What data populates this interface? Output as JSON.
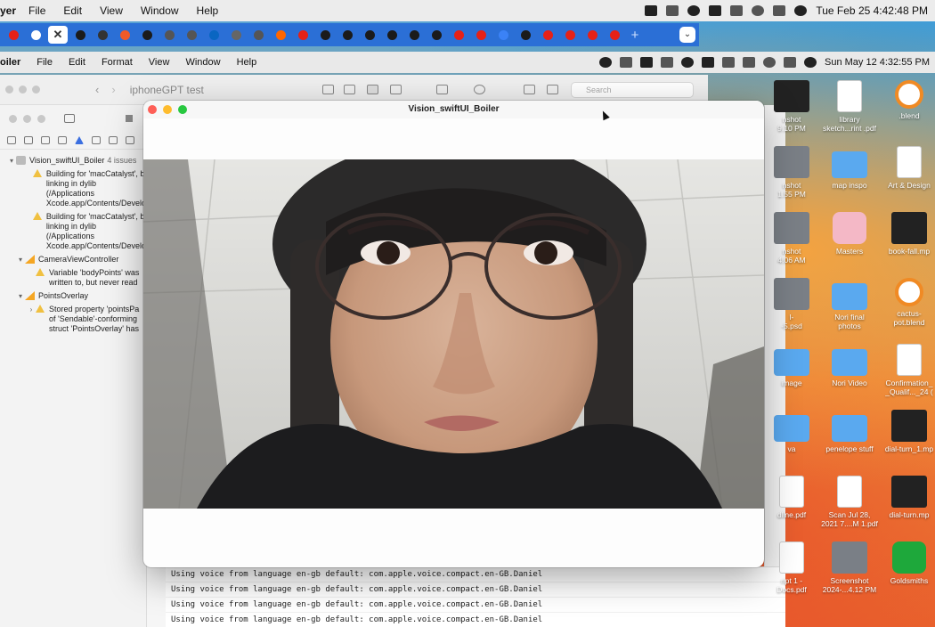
{
  "outer_menubar": {
    "app_name": "yer",
    "items": [
      "File",
      "Edit",
      "View",
      "Window",
      "Help"
    ],
    "datetime": "Tue Feb 25  4:42:48 PM"
  },
  "browser_tabs": {
    "favicon_colors": [
      "#e62117",
      "#ffffff",
      "#1b1b1b",
      "#333333",
      "#f05a28",
      "#1b1b1b",
      "#555555",
      "#555555",
      "#0a66c2",
      "#666666",
      "#555555",
      "#ff6600",
      "#e62117",
      "#1b1b1b",
      "#1b1b1b",
      "#1b1b1b",
      "#1b1b1b",
      "#1b1b1b",
      "#1b1b1b",
      "#e62117",
      "#e62117",
      "#3b82f6",
      "#1b1b1b",
      "#e62117",
      "#e62117",
      "#e62117",
      "#e62117"
    ],
    "active_tab_symbol": "✕",
    "new_tab_symbol": "+"
  },
  "inner_menubar": {
    "app_name": "oiler",
    "items": [
      "File",
      "Edit",
      "Format",
      "View",
      "Window",
      "Help"
    ],
    "datetime": "Sun May 12  4:32:55 PM"
  },
  "xcode": {
    "scheme_title": "iphoneGPT test",
    "search_placeholder": "Search",
    "issue_tree": [
      {
        "kind": "project",
        "caret": "▾",
        "label": "Vision_swiftUI_Boiler",
        "badge": "4 issues"
      },
      {
        "kind": "warning",
        "caret": "",
        "label": "Building for 'macCatalyst', b\nlinking in dylib (/Applications\nXcode.app/Contents/Develo"
      },
      {
        "kind": "warning",
        "caret": "",
        "label": "Building for 'macCatalyst', b\nlinking in dylib (/Applications\nXcode.app/Contents/Develo"
      },
      {
        "kind": "swift",
        "caret": "▾",
        "label": "CameraViewController"
      },
      {
        "kind": "warning",
        "caret": "",
        "label": "Variable 'bodyPoints' was\nwritten to, but never read"
      },
      {
        "kind": "swift",
        "caret": "▾",
        "label": "PointsOverlay"
      },
      {
        "kind": "warning",
        "caret": "›",
        "label": "Stored property 'pointsPa\nof 'Sendable'-conforming\nstruct 'PointsOverlay' has"
      }
    ]
  },
  "console": {
    "lines": [
      "Using voice from language en-gb default: com.apple.voice.compact.en-GB.Daniel",
      "Using voice from language en-gb default: com.apple.voice.compact.en-GB.Daniel",
      "Using voice from language en-gb default: com.apple.voice.compact.en-GB.Daniel",
      "Using voice from language en-gb default: com.apple.voice.compact.en-GB.Daniel"
    ]
  },
  "vision_window": {
    "title": "Vision_swiftUI_Boiler"
  },
  "desktop": {
    "items": [
      {
        "label": "nshot\n9.10 PM",
        "thumb": "dark"
      },
      {
        "label": "library\nsketch...rint .pdf",
        "thumb": "doc"
      },
      {
        "label": ".blend",
        "thumb": "blend"
      },
      {
        "label": "nshot\n1.55 PM",
        "thumb": "photo"
      },
      {
        "label": "map inspo",
        "thumb": "folder"
      },
      {
        "label": "Art & Design",
        "thumb": "doc"
      },
      {
        "label": "nshot\n4.06 AM",
        "thumb": "photo"
      },
      {
        "label": "Masters",
        "thumb": "pink"
      },
      {
        "label": "book-fall.mp",
        "thumb": "dark"
      },
      {
        "label": "l-\n-5.psd",
        "thumb": "photo"
      },
      {
        "label": "Nori final\nphotos",
        "thumb": "folder"
      },
      {
        "label": "cactus-\npot.blend",
        "thumb": "blend"
      },
      {
        "label": "image",
        "thumb": "folder"
      },
      {
        "label": "Nori Video",
        "thumb": "folder"
      },
      {
        "label": "Confirmation_\n_Qualif..._24 (",
        "thumb": "doc"
      },
      {
        "label": "va",
        "thumb": "folder"
      },
      {
        "label": "penelope stuff",
        "thumb": "folder"
      },
      {
        "label": "dial-turn_1.mp",
        "thumb": "dark"
      },
      {
        "label": "dline.pdf",
        "thumb": "doc"
      },
      {
        "label": "Scan Jul 28,\n2021 7....M 1.pdf",
        "thumb": "doc"
      },
      {
        "label": "dial-turn.mp",
        "thumb": "dark"
      },
      {
        "label": "ript 1 -\nDocs.pdf",
        "thumb": "doc"
      },
      {
        "label": "Screenshot\n2024-...4.12 PM",
        "thumb": "photo"
      },
      {
        "label": "Goldsmiths",
        "thumb": "green"
      }
    ]
  },
  "colors": {
    "traffic_red": "#fe5f57",
    "traffic_yellow": "#febc2e",
    "traffic_green": "#28c840",
    "warning_yellow": "#f0c040",
    "tabstrip_blue": "#2b6fd6"
  }
}
